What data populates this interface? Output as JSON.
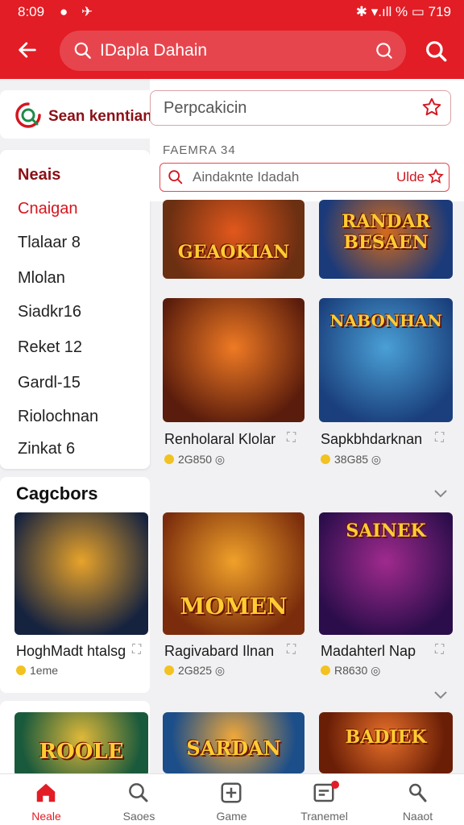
{
  "status_bar": {
    "time": "8:09",
    "left_icons": "● ✈",
    "right": "✱ ▾.ıll % ▭ 719"
  },
  "search": {
    "query": "IDapla Dahain"
  },
  "side_search": {
    "label": "Sean kenntiani"
  },
  "nav": {
    "title": "Neais",
    "items": [
      "Cnaigan",
      "Tlalaar 8",
      "Mlolan",
      "Siadkr16",
      "Reket 12",
      "Gardl-15",
      "Riolochnan",
      "Zinkat 6"
    ]
  },
  "right_panel": {
    "field1": "Perpcakicin",
    "section": "FAEMRA 34",
    "field2": {
      "placeholder": "Aindaknte Idadah",
      "right": "Ulde"
    }
  },
  "cards": [
    {
      "art": "GEAOKIAN",
      "title": "",
      "meta": "",
      "colors": [
        "#6b2f12",
        "#e2581c"
      ]
    },
    {
      "art": "RANDAR BESAEN",
      "title": "",
      "meta": "",
      "colors": [
        "#1b3a7a",
        "#d46a1b"
      ]
    },
    {
      "art": "",
      "title": "Renholaral Klolar",
      "meta": "2G850",
      "colors": [
        "#5a1c0c",
        "#ef7a24"
      ]
    },
    {
      "art": "NABONHAN",
      "title": "Sapkbhdarknan",
      "meta": "38G85",
      "colors": [
        "#1a3f7c",
        "#4aa0d6"
      ]
    },
    {
      "art": "MOMEN",
      "title": "Ragivabard Ilnan",
      "meta": "2G825",
      "colors": [
        "#7a2c0c",
        "#f0a12a"
      ]
    },
    {
      "art": "SAINEK",
      "title": "Madahterl Nap",
      "meta": "R8630",
      "colors": [
        "#2a0d4a",
        "#a02a8e"
      ]
    },
    {
      "art": "SARDAN",
      "title": "",
      "meta": "",
      "colors": [
        "#1c4e8a",
        "#f0a83a"
      ]
    },
    {
      "art": "BADIEK",
      "title": "",
      "meta": "",
      "colors": [
        "#6a1e06",
        "#e8702a"
      ]
    }
  ],
  "categories": {
    "title": "Cagcbors",
    "card": {
      "art": "",
      "title": "HoghMadt htalsg",
      "meta": "1eme",
      "colors": [
        "#16233f",
        "#e8a32a"
      ]
    },
    "bottom_card": {
      "art": "ROOLE",
      "colors": [
        "#1a5a3c",
        "#e0b83a"
      ]
    }
  },
  "bottom_nav": [
    {
      "label": "Neale",
      "icon": "home-icon"
    },
    {
      "label": "Saoes",
      "icon": "search-icon"
    },
    {
      "label": "Game",
      "icon": "plus-square-icon"
    },
    {
      "label": "Tranemel",
      "icon": "inbox-icon"
    },
    {
      "label": "Naaot",
      "icon": "profile-icon"
    }
  ],
  "colors": {
    "brand": "#e21d26",
    "dark_red": "#8b1016"
  }
}
